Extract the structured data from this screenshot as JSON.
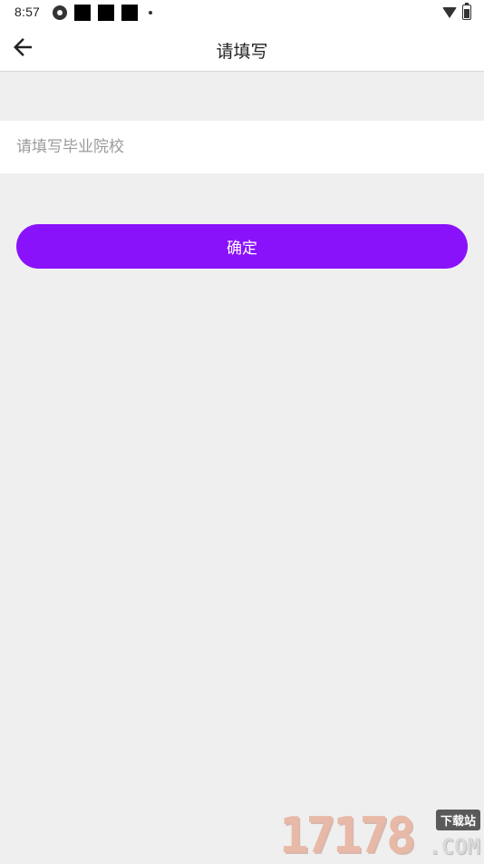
{
  "status_bar": {
    "time": "8:57",
    "left_icons": [
      "aperture-icon",
      "square-icon",
      "square-icon",
      "square-icon",
      "dot-icon"
    ],
    "right_icons": [
      "wifi-icon",
      "battery-icon"
    ]
  },
  "nav": {
    "title": "请填写",
    "back_icon": "arrow-left-icon"
  },
  "form": {
    "school_input": {
      "value": "",
      "placeholder": "请填写毕业院校"
    },
    "confirm_label": "确定"
  },
  "watermark": {
    "digits": "17178",
    "badge": "下载站",
    "suffix": ".COM"
  },
  "colors": {
    "primary": "#8a12fb",
    "background": "#efefef",
    "surface": "#ffffff",
    "placeholder": "#9b9b9b"
  }
}
